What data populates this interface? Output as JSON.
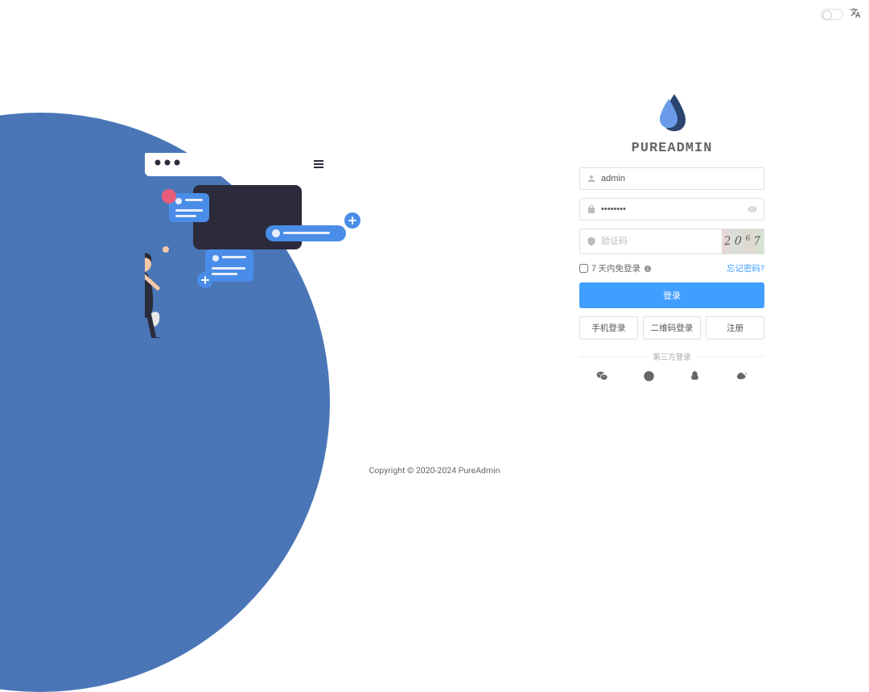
{
  "brand": "PUREADMIN",
  "form": {
    "username_value": "admin",
    "password_value": "********",
    "captcha_placeholder": "验证码",
    "captcha_display": [
      "2",
      "0",
      "6",
      "7"
    ],
    "remember_label": "7 天内免登录",
    "forgot_label": "忘记密码?",
    "login_label": "登录",
    "phone_login_label": "手机登录",
    "qr_login_label": "二维码登录",
    "register_label": "注册",
    "third_party_label": "第三方登录"
  },
  "footer": "Copyright © 2020-2024 PureAdmin",
  "colors": {
    "primary": "#409eff",
    "blob": "#4A76B8"
  }
}
